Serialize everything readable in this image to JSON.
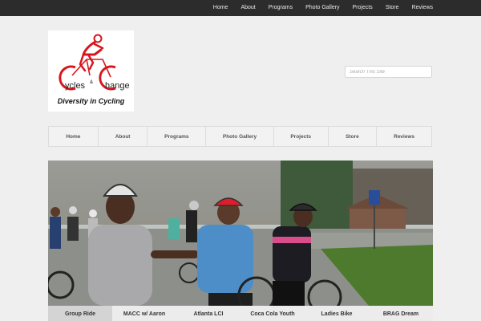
{
  "top_nav": [
    "Home",
    "About",
    "Programs",
    "Photo Gallery",
    "Projects",
    "Store",
    "Reviews"
  ],
  "logo": {
    "name_left": "ycles",
    "name_amp": "&",
    "name_right": "hange",
    "tagline": "Diversity in Cycling"
  },
  "search": {
    "placeholder": "Search This Site"
  },
  "main_nav": [
    "Home",
    "About",
    "Programs",
    "Photo Gallery",
    "Projects",
    "Store",
    "Reviews"
  ],
  "slider": {
    "tabs": [
      "Group Ride",
      "MACC w/ Aaron",
      "Atlanta LCI",
      "Coca Cola Youth",
      "Ladies Bike",
      "BRAG Dream"
    ],
    "active_index": 0
  },
  "colors": {
    "topbar": "#2c2c2c",
    "logo_red": "#d8151c",
    "background": "#efefef"
  }
}
